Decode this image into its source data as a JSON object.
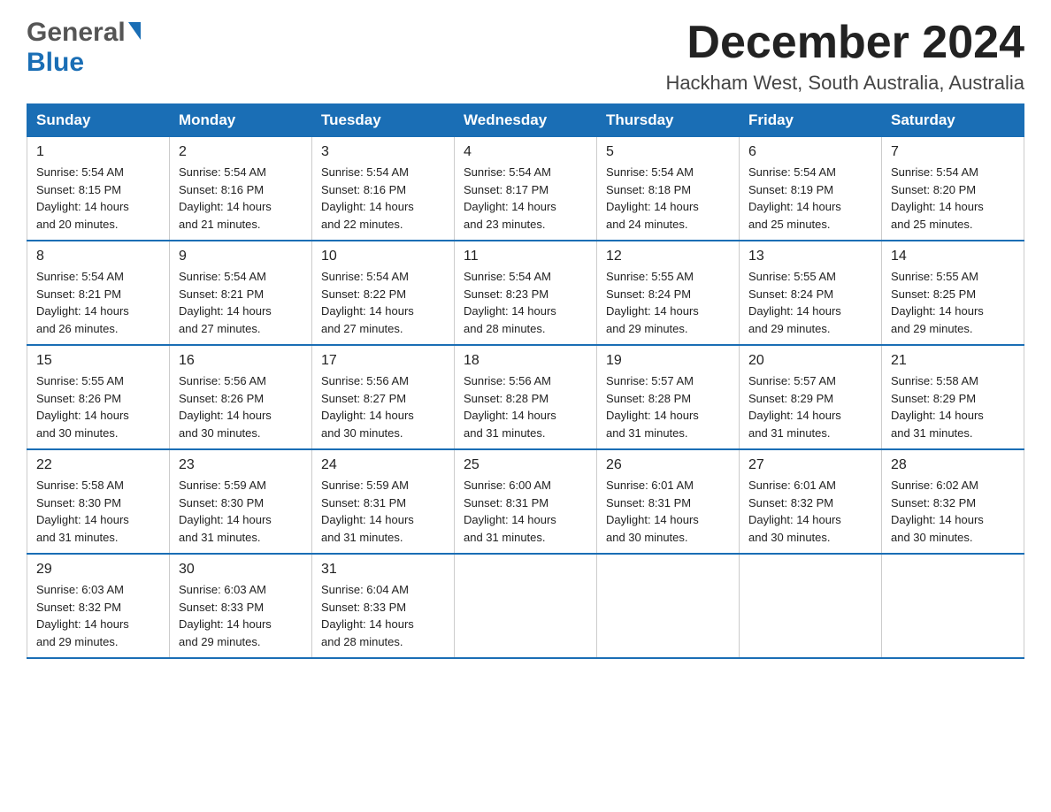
{
  "logo": {
    "general": "General",
    "blue": "Blue",
    "triangle": "▶"
  },
  "title": {
    "month": "December 2024",
    "location": "Hackham West, South Australia, Australia"
  },
  "weekdays": [
    "Sunday",
    "Monday",
    "Tuesday",
    "Wednesday",
    "Thursday",
    "Friday",
    "Saturday"
  ],
  "weeks": [
    [
      {
        "day": "1",
        "sunrise": "5:54 AM",
        "sunset": "8:15 PM",
        "daylight": "14 hours and 20 minutes."
      },
      {
        "day": "2",
        "sunrise": "5:54 AM",
        "sunset": "8:16 PM",
        "daylight": "14 hours and 21 minutes."
      },
      {
        "day": "3",
        "sunrise": "5:54 AM",
        "sunset": "8:16 PM",
        "daylight": "14 hours and 22 minutes."
      },
      {
        "day": "4",
        "sunrise": "5:54 AM",
        "sunset": "8:17 PM",
        "daylight": "14 hours and 23 minutes."
      },
      {
        "day": "5",
        "sunrise": "5:54 AM",
        "sunset": "8:18 PM",
        "daylight": "14 hours and 24 minutes."
      },
      {
        "day": "6",
        "sunrise": "5:54 AM",
        "sunset": "8:19 PM",
        "daylight": "14 hours and 25 minutes."
      },
      {
        "day": "7",
        "sunrise": "5:54 AM",
        "sunset": "8:20 PM",
        "daylight": "14 hours and 25 minutes."
      }
    ],
    [
      {
        "day": "8",
        "sunrise": "5:54 AM",
        "sunset": "8:21 PM",
        "daylight": "14 hours and 26 minutes."
      },
      {
        "day": "9",
        "sunrise": "5:54 AM",
        "sunset": "8:21 PM",
        "daylight": "14 hours and 27 minutes."
      },
      {
        "day": "10",
        "sunrise": "5:54 AM",
        "sunset": "8:22 PM",
        "daylight": "14 hours and 27 minutes."
      },
      {
        "day": "11",
        "sunrise": "5:54 AM",
        "sunset": "8:23 PM",
        "daylight": "14 hours and 28 minutes."
      },
      {
        "day": "12",
        "sunrise": "5:55 AM",
        "sunset": "8:24 PM",
        "daylight": "14 hours and 29 minutes."
      },
      {
        "day": "13",
        "sunrise": "5:55 AM",
        "sunset": "8:24 PM",
        "daylight": "14 hours and 29 minutes."
      },
      {
        "day": "14",
        "sunrise": "5:55 AM",
        "sunset": "8:25 PM",
        "daylight": "14 hours and 29 minutes."
      }
    ],
    [
      {
        "day": "15",
        "sunrise": "5:55 AM",
        "sunset": "8:26 PM",
        "daylight": "14 hours and 30 minutes."
      },
      {
        "day": "16",
        "sunrise": "5:56 AM",
        "sunset": "8:26 PM",
        "daylight": "14 hours and 30 minutes."
      },
      {
        "day": "17",
        "sunrise": "5:56 AM",
        "sunset": "8:27 PM",
        "daylight": "14 hours and 30 minutes."
      },
      {
        "day": "18",
        "sunrise": "5:56 AM",
        "sunset": "8:28 PM",
        "daylight": "14 hours and 31 minutes."
      },
      {
        "day": "19",
        "sunrise": "5:57 AM",
        "sunset": "8:28 PM",
        "daylight": "14 hours and 31 minutes."
      },
      {
        "day": "20",
        "sunrise": "5:57 AM",
        "sunset": "8:29 PM",
        "daylight": "14 hours and 31 minutes."
      },
      {
        "day": "21",
        "sunrise": "5:58 AM",
        "sunset": "8:29 PM",
        "daylight": "14 hours and 31 minutes."
      }
    ],
    [
      {
        "day": "22",
        "sunrise": "5:58 AM",
        "sunset": "8:30 PM",
        "daylight": "14 hours and 31 minutes."
      },
      {
        "day": "23",
        "sunrise": "5:59 AM",
        "sunset": "8:30 PM",
        "daylight": "14 hours and 31 minutes."
      },
      {
        "day": "24",
        "sunrise": "5:59 AM",
        "sunset": "8:31 PM",
        "daylight": "14 hours and 31 minutes."
      },
      {
        "day": "25",
        "sunrise": "6:00 AM",
        "sunset": "8:31 PM",
        "daylight": "14 hours and 31 minutes."
      },
      {
        "day": "26",
        "sunrise": "6:01 AM",
        "sunset": "8:31 PM",
        "daylight": "14 hours and 30 minutes."
      },
      {
        "day": "27",
        "sunrise": "6:01 AM",
        "sunset": "8:32 PM",
        "daylight": "14 hours and 30 minutes."
      },
      {
        "day": "28",
        "sunrise": "6:02 AM",
        "sunset": "8:32 PM",
        "daylight": "14 hours and 30 minutes."
      }
    ],
    [
      {
        "day": "29",
        "sunrise": "6:03 AM",
        "sunset": "8:32 PM",
        "daylight": "14 hours and 29 minutes."
      },
      {
        "day": "30",
        "sunrise": "6:03 AM",
        "sunset": "8:33 PM",
        "daylight": "14 hours and 29 minutes."
      },
      {
        "day": "31",
        "sunrise": "6:04 AM",
        "sunset": "8:33 PM",
        "daylight": "14 hours and 28 minutes."
      },
      null,
      null,
      null,
      null
    ]
  ],
  "labels": {
    "sunrise": "Sunrise: ",
    "sunset": "Sunset: ",
    "daylight": "Daylight: "
  }
}
